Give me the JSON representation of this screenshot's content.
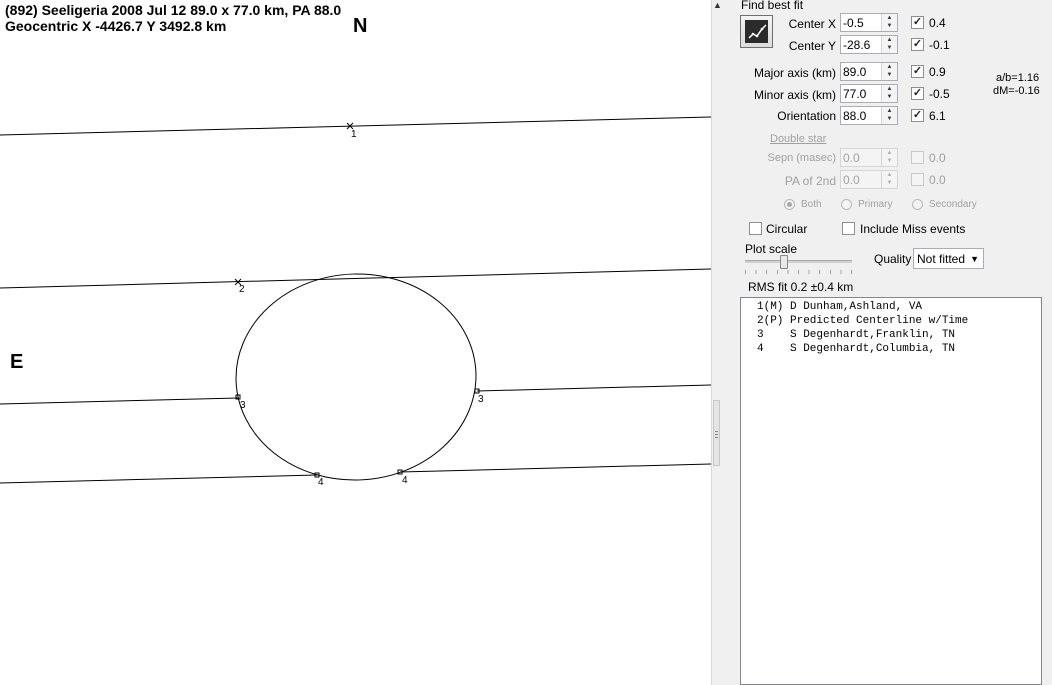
{
  "plot": {
    "title_line1": "(892) Seeligeria  2008 Jul 12   89.0 x 77.0 km, PA 88.0",
    "title_line2": "Geocentric  X  -4426.7  Y 3492.8 km",
    "north_label": "N",
    "east_label": "E",
    "chord_labels": [
      "1",
      "2",
      "3",
      "3",
      "4",
      "4"
    ]
  },
  "panel": {
    "find_best_fit_label": "Find best fit",
    "center_x": {
      "label": "Center X",
      "value": "-0.5",
      "checked": true,
      "delta": "0.4"
    },
    "center_y": {
      "label": "Center Y",
      "value": "-28.6",
      "checked": true,
      "delta": "-0.1"
    },
    "major_axis": {
      "label": "Major axis (km)",
      "value": "89.0",
      "checked": true,
      "delta": "0.9"
    },
    "minor_axis": {
      "label": "Minor axis (km)",
      "value": "77.0",
      "checked": true,
      "delta": "-0.5"
    },
    "orientation": {
      "label": "Orientation",
      "value": "88.0",
      "checked": true,
      "delta": "6.1"
    },
    "ratio_text": "a/b=1.16",
    "dm_text": "dM=-0.16",
    "double_star_label": "Double star",
    "sepn": {
      "label": "Sepn (masec)",
      "value": "0.0",
      "checked": false,
      "delta": "0.0"
    },
    "pa_of_2nd": {
      "label": "PA of 2nd",
      "value": "0.0",
      "checked": false,
      "delta": "0.0"
    },
    "radio_both": "Both",
    "radio_primary": "Primary",
    "radio_secondary": "Secondary",
    "circular_label": "Circular",
    "include_miss_label": "Include Miss events",
    "plot_scale_label": "Plot scale",
    "quality_label": "Quality",
    "quality_value": "Not fitted",
    "rms_fit": "RMS fit 0.2 ±0.4 km",
    "observers": [
      "1(M) D Dunham,Ashland, VA",
      "2(P) Predicted Centerline w/Time",
      "3    S Degenhardt,Franklin, TN",
      "4    S Degenhardt,Columbia, TN"
    ]
  },
  "icons": {
    "fit_button": "chart-fit-icon",
    "scroll_up": "scroll-up-arrow-icon",
    "splitter": "splitter-grip-icon",
    "dropdown": "chevron-down-icon"
  }
}
